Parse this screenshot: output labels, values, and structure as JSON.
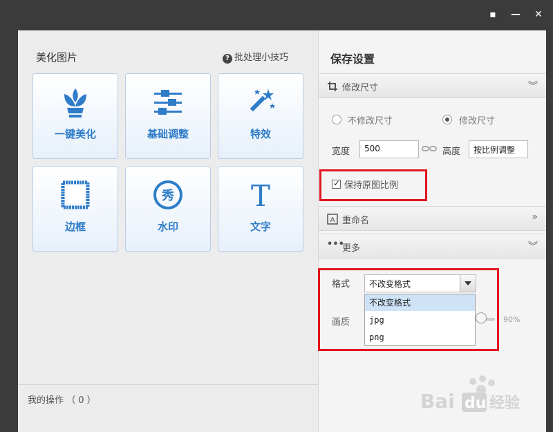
{
  "window": {
    "buttons": {
      "chat": "▪",
      "minimize": "—",
      "close": "✕"
    }
  },
  "left": {
    "title": "美化图片",
    "tips_label": "批处理小技巧",
    "tiles": [
      {
        "label": "一键美化",
        "icon": "tulip-icon"
      },
      {
        "label": "基础调整",
        "icon": "sliders-icon"
      },
      {
        "label": "特效",
        "icon": "magic-wand-icon"
      },
      {
        "label": "边框",
        "icon": "frame-icon"
      },
      {
        "label": "水印",
        "icon": "watermark-stamp-icon"
      },
      {
        "label": "文字",
        "icon": "text-T-icon"
      }
    ],
    "my_ops": "我的操作 （ 0 ）"
  },
  "right": {
    "title": "保存设置",
    "resize": {
      "header": "修改尺寸",
      "opt_keep": "不修改尺寸",
      "opt_change": "修改尺寸",
      "width_label": "宽度",
      "width_value": "500",
      "height_label": "高度",
      "height_value": "按比例调整",
      "keep_ratio": "保持原图比例"
    },
    "rename": {
      "header": "重命名"
    },
    "more": {
      "header": "更多",
      "format_label": "格式",
      "format_value": "不改变格式",
      "format_options": [
        "不改变格式",
        "jpg",
        "png"
      ],
      "quality_label": "画质",
      "quality_value": "90%"
    }
  },
  "watermark_text": "Bai du 经验"
}
